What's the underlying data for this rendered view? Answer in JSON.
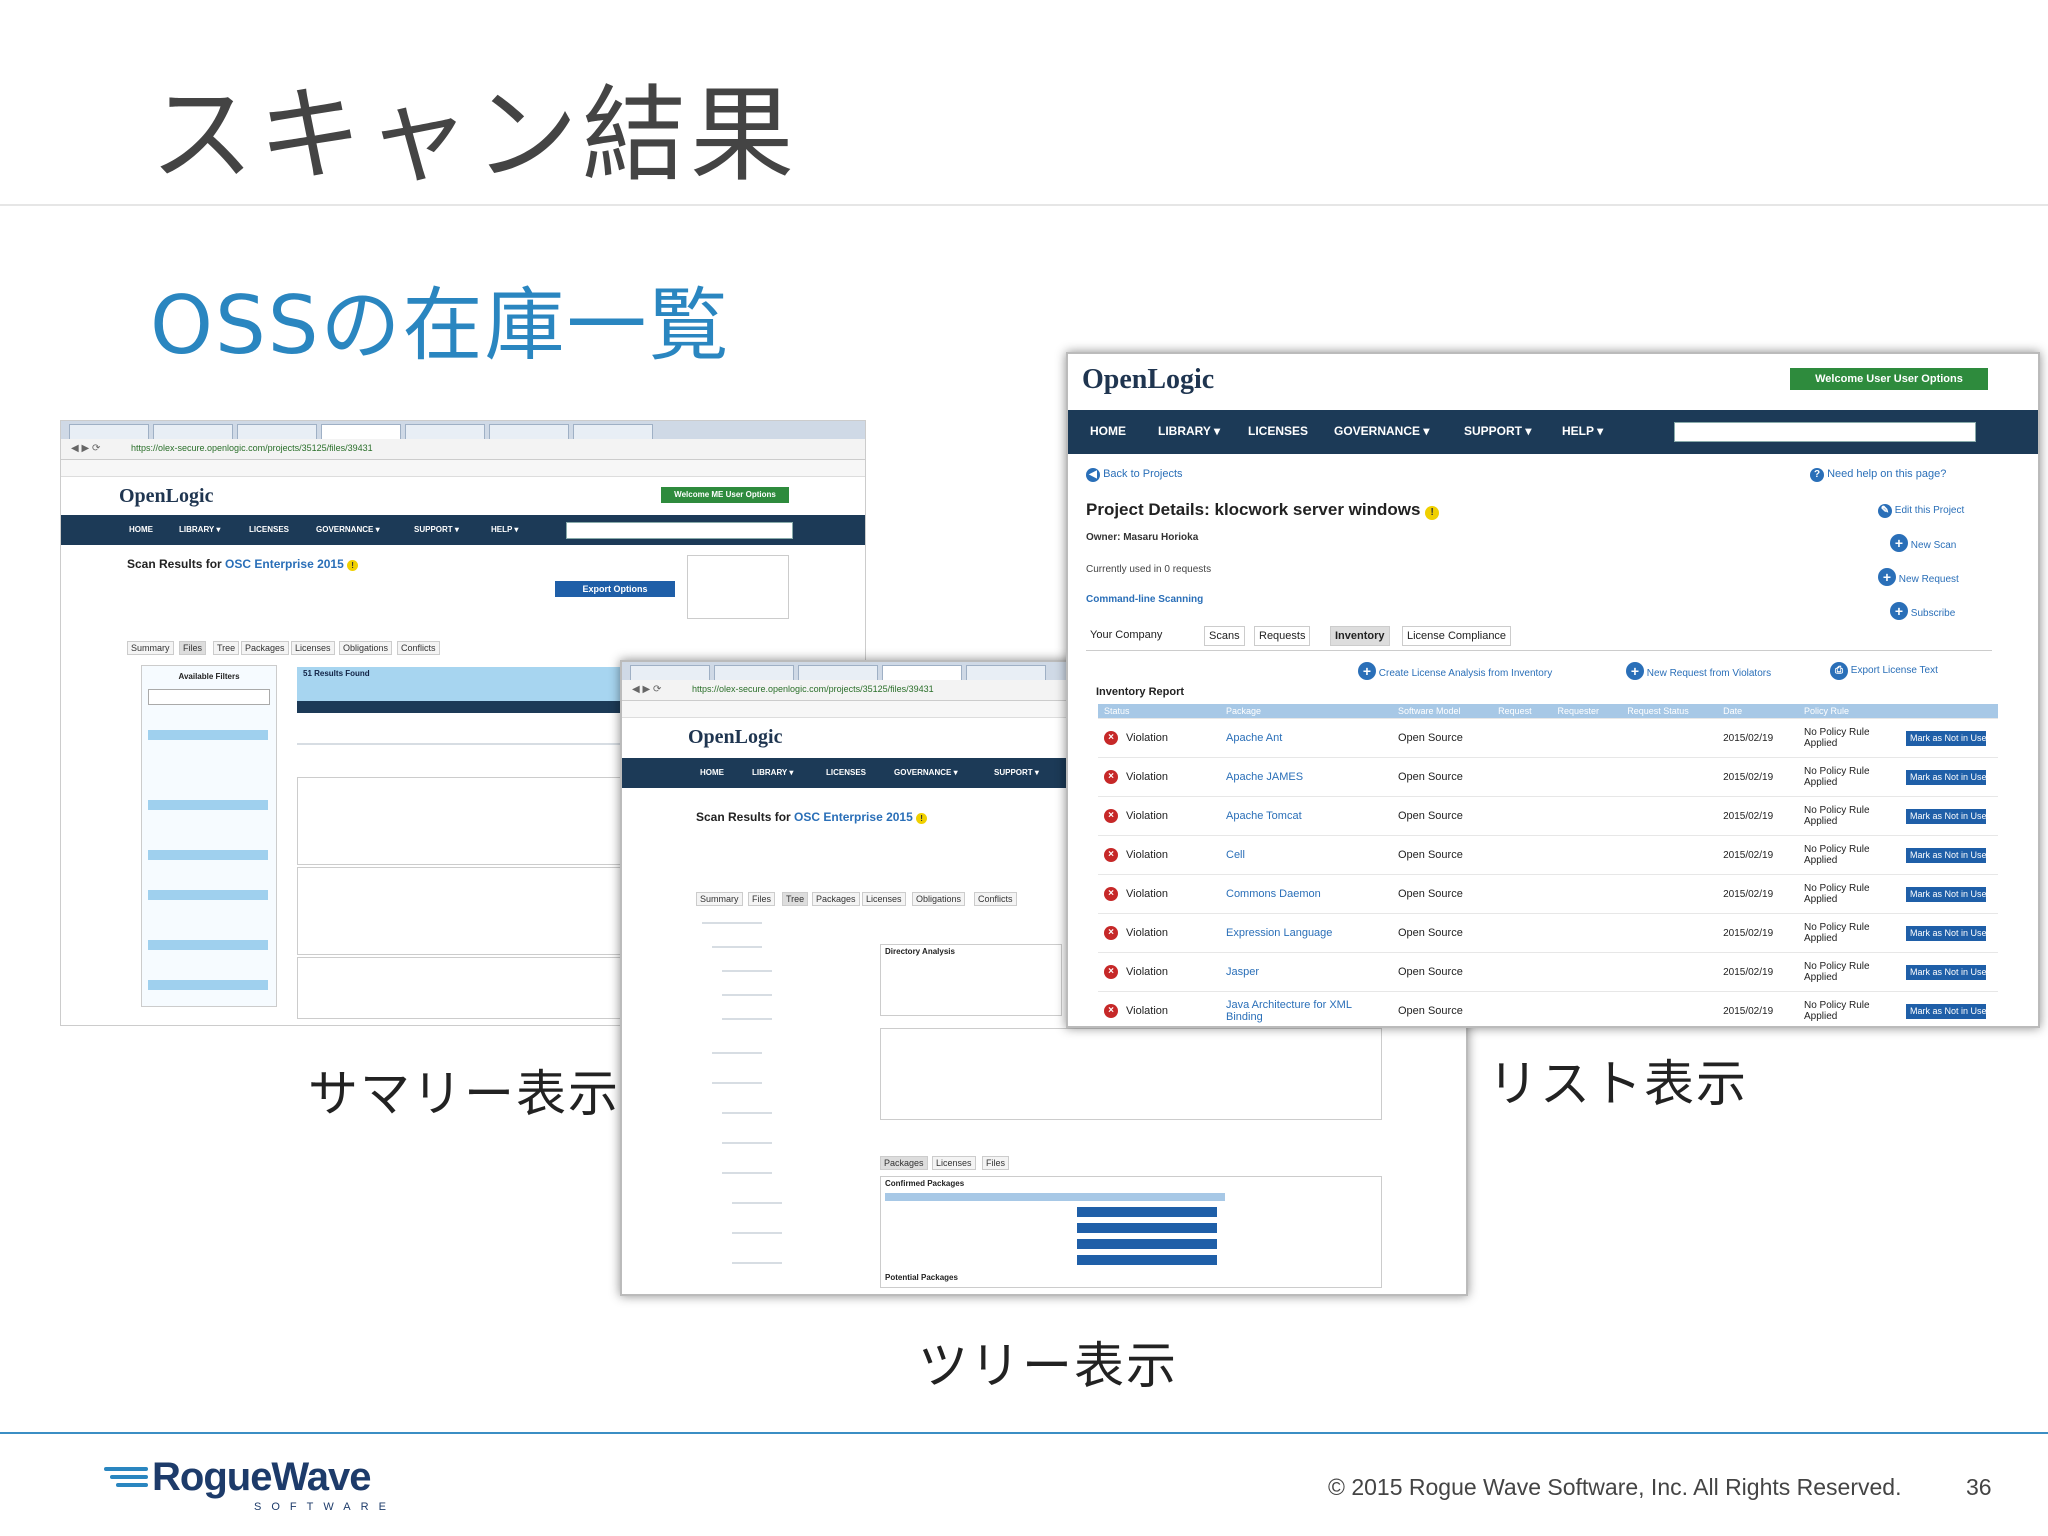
{
  "slide": {
    "title": "スキャン結果",
    "subtitle": "OSSの在庫一覧",
    "captions": {
      "summary": "サマリー表示",
      "list": "リスト表示",
      "tree": "ツリー表示"
    },
    "footer": {
      "copyright": "© 2015 Rogue Wave Software, Inc. All Rights Reserved.",
      "page_number": "36",
      "logo_word": "RogueWave",
      "logo_sub": "SOFTWARE"
    }
  },
  "summary_shot": {
    "url": "https://olex-secure.openlogic.com/projects/35125/files/39431",
    "logo": "OpenLogic",
    "nav": [
      "HOME",
      "LIBRARY ▾",
      "LICENSES",
      "GOVERNANCE ▾",
      "SUPPORT ▾",
      "HELP ▾"
    ],
    "welcome_button": "Welcome ME User Options",
    "scan_title": "Scan Results for",
    "scan_project": "OSC Enterprise 2015",
    "export_button": "Export Options",
    "tabs": [
      "Summary",
      "Files",
      "Tree",
      "Packages",
      "Licenses",
      "Obligations",
      "Conflicts"
    ],
    "available_filters": "Available Filters",
    "results_found": "51 Results Found"
  },
  "tree_shot": {
    "url": "https://olex-secure.openlogic.com/projects/35125/files/39431",
    "logo": "OpenLogic",
    "nav": [
      "HOME",
      "LIBRARY ▾",
      "LICENSES",
      "GOVERNANCE ▾",
      "SUPPORT ▾"
    ],
    "scan_title": "Scan Results for",
    "scan_project": "OSC Enterprise 2015",
    "tabs": [
      "Summary",
      "Files",
      "Tree",
      "Packages",
      "Licenses",
      "Obligations",
      "Conflicts"
    ],
    "directory_analysis": "Directory Analysis",
    "package_tabs": [
      "Packages",
      "Licenses",
      "Files"
    ],
    "confirmed_packages": "Confirmed Packages",
    "potential_packages": "Potential Packages"
  },
  "list_shot": {
    "logo": "OpenLogic",
    "welcome_button": "Welcome User User Options",
    "nav": [
      "HOME",
      "LIBRARY ▾",
      "LICENSES",
      "GOVERNANCE ▾",
      "SUPPORT ▾",
      "HELP ▾"
    ],
    "back_link": "Back to Projects",
    "help_link": "Need help on this page?",
    "project_title": "Project Details: klocwork server windows",
    "owner": "Owner: Masaru Horioka",
    "usage": "Currently used in 0 requests",
    "cmd_scanning": "Command-line Scanning",
    "side_actions": [
      "Edit this Project",
      "New Scan",
      "New Request",
      "Subscribe"
    ],
    "tabs": [
      "Your Company",
      "Scans",
      "Requests",
      "Inventory",
      "License Compliance"
    ],
    "inventory_report": "Inventory Report",
    "report_actions": [
      "Create License Analysis from Inventory",
      "New Request from Violators",
      "Export License Text"
    ],
    "columns": [
      "Status",
      "Package",
      "Software Model",
      "Request",
      "Requester",
      "Request Status",
      "Date",
      "Policy Rule"
    ],
    "rows": [
      {
        "status": "Violation",
        "package": "Apache Ant",
        "model": "Open Source",
        "date": "2015/02/19",
        "rule": "No Policy Rule Applied",
        "action": "Mark as Not in Use"
      },
      {
        "status": "Violation",
        "package": "Apache JAMES",
        "model": "Open Source",
        "date": "2015/02/19",
        "rule": "No Policy Rule Applied",
        "action": "Mark as Not in Use"
      },
      {
        "status": "Violation",
        "package": "Apache Tomcat",
        "model": "Open Source",
        "date": "2015/02/19",
        "rule": "No Policy Rule Applied",
        "action": "Mark as Not in Use"
      },
      {
        "status": "Violation",
        "package": "Cell",
        "model": "Open Source",
        "date": "2015/02/19",
        "rule": "No Policy Rule Applied",
        "action": "Mark as Not in Use"
      },
      {
        "status": "Violation",
        "package": "Commons Daemon",
        "model": "Open Source",
        "date": "2015/02/19",
        "rule": "No Policy Rule Applied",
        "action": "Mark as Not in Use"
      },
      {
        "status": "Violation",
        "package": "Expression Language",
        "model": "Open Source",
        "date": "2015/02/19",
        "rule": "No Policy Rule Applied",
        "action": "Mark as Not in Use"
      },
      {
        "status": "Violation",
        "package": "Jasper",
        "model": "Open Source",
        "date": "2015/02/19",
        "rule": "No Policy Rule Applied",
        "action": "Mark as Not in Use"
      },
      {
        "status": "Violation",
        "package": "Java Architecture for XML Binding",
        "model": "Open Source",
        "date": "2015/02/19",
        "rule": "No Policy Rule Applied",
        "action": "Mark as Not in Use"
      }
    ]
  }
}
